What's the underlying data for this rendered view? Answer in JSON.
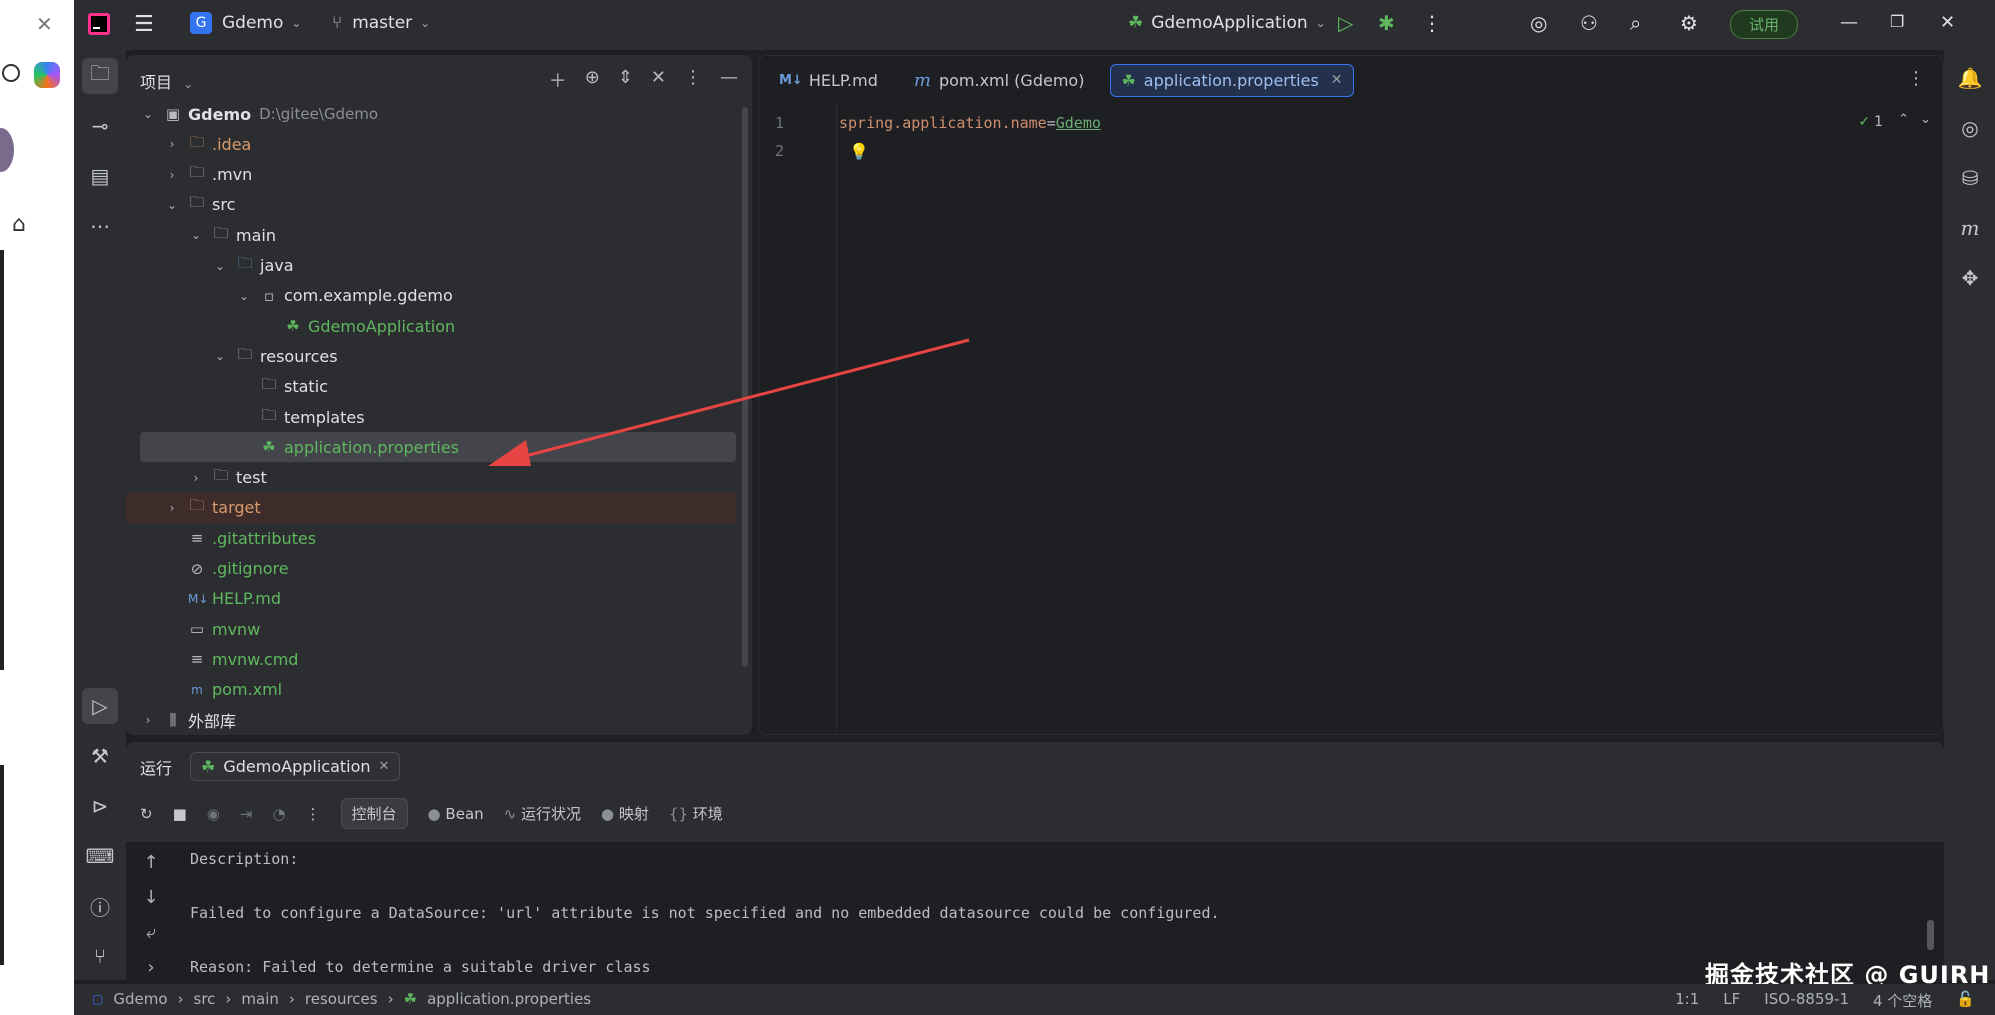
{
  "titlebar": {
    "project_badge": "G",
    "project_name": "Gdemo",
    "branch": "master",
    "run_config": "GdemoApplication",
    "trial_label": "试用"
  },
  "project_panel": {
    "title": "项目",
    "tree": [
      {
        "label": "Gdemo",
        "path": "D:\\gitee\\Gdemo",
        "depth": 0,
        "arrow": "down",
        "icon": "module-folder-icon"
      },
      {
        "label": ".idea",
        "depth": 1,
        "arrow": "right",
        "icon": "folder-icon",
        "color": "orange"
      },
      {
        "label": ".mvn",
        "depth": 1,
        "arrow": "right",
        "icon": "folder-icon"
      },
      {
        "label": "src",
        "depth": 1,
        "arrow": "down",
        "icon": "folder-icon"
      },
      {
        "label": "main",
        "depth": 2,
        "arrow": "down",
        "icon": "folder-icon"
      },
      {
        "label": "java",
        "depth": 3,
        "arrow": "down",
        "icon": "source-folder-icon"
      },
      {
        "label": "com.example.gdemo",
        "depth": 4,
        "arrow": "down",
        "icon": "package-icon"
      },
      {
        "label": "GdemoApplication",
        "depth": 5,
        "arrow": "",
        "icon": "spring-class-icon",
        "color": "green"
      },
      {
        "label": "resources",
        "depth": 3,
        "arrow": "down",
        "icon": "resources-folder-icon"
      },
      {
        "label": "static",
        "depth": 4,
        "arrow": "",
        "icon": "folder-icon"
      },
      {
        "label": "templates",
        "depth": 4,
        "arrow": "",
        "icon": "folder-icon"
      },
      {
        "label": "application.properties",
        "depth": 4,
        "arrow": "",
        "icon": "spring-properties-icon",
        "color": "green",
        "selected": true
      },
      {
        "label": "test",
        "depth": 2,
        "arrow": "right",
        "icon": "folder-icon"
      },
      {
        "label": "target",
        "depth": 1,
        "arrow": "right",
        "icon": "folder-icon",
        "color": "orange",
        "excluded": true
      },
      {
        "label": ".gitattributes",
        "depth": 1,
        "arrow": "",
        "icon": "text-file-icon",
        "color": "green"
      },
      {
        "label": ".gitignore",
        "depth": 1,
        "arrow": "",
        "icon": "ignore-file-icon",
        "color": "green"
      },
      {
        "label": "HELP.md",
        "depth": 1,
        "arrow": "",
        "icon": "markdown-icon",
        "color": "green"
      },
      {
        "label": "mvnw",
        "depth": 1,
        "arrow": "",
        "icon": "shell-script-icon",
        "color": "green"
      },
      {
        "label": "mvnw.cmd",
        "depth": 1,
        "arrow": "",
        "icon": "text-file-icon",
        "color": "green"
      },
      {
        "label": "pom.xml",
        "depth": 1,
        "arrow": "",
        "icon": "maven-icon",
        "color": "green"
      },
      {
        "label": "外部库",
        "depth": 0,
        "arrow": "right",
        "icon": "library-icon"
      }
    ]
  },
  "editor": {
    "tabs": [
      {
        "label": "HELP.md",
        "icon": "markdown-icon"
      },
      {
        "label": "pom.xml (Gdemo)",
        "icon": "maven-icon"
      },
      {
        "label": "application.properties",
        "icon": "spring-properties-icon",
        "active": true
      }
    ],
    "line_numbers": [
      "1",
      "2"
    ],
    "code": {
      "key": "spring.application.name",
      "eq": "=",
      "value": "Gdemo"
    },
    "inspection_count": "1"
  },
  "run_panel": {
    "title": "运行",
    "tab_label": "GdemoApplication",
    "toolbar": {
      "console": "控制台",
      "bean": "Bean",
      "health": "运行状况",
      "mapping": "映射",
      "env": "环境"
    },
    "console_lines": [
      "Description:",
      "",
      "Failed to configure a DataSource: 'url' attribute is not specified and no embedded datasource could be configured.",
      "",
      "Reason: Failed to determine a suitable driver class"
    ]
  },
  "statusbar": {
    "breadcrumbs": [
      "Gdemo",
      "src",
      "main",
      "resources",
      "application.properties"
    ],
    "position": "1:1",
    "line_sep": "LF",
    "encoding": "ISO-8859-1",
    "indent": "4 个空格"
  },
  "watermark": "掘金技术社区 @ GUIRH",
  "colors": {
    "accent": "#3574f0",
    "arrow_annotation": "#e84444",
    "green_file": "#5fb85f"
  }
}
